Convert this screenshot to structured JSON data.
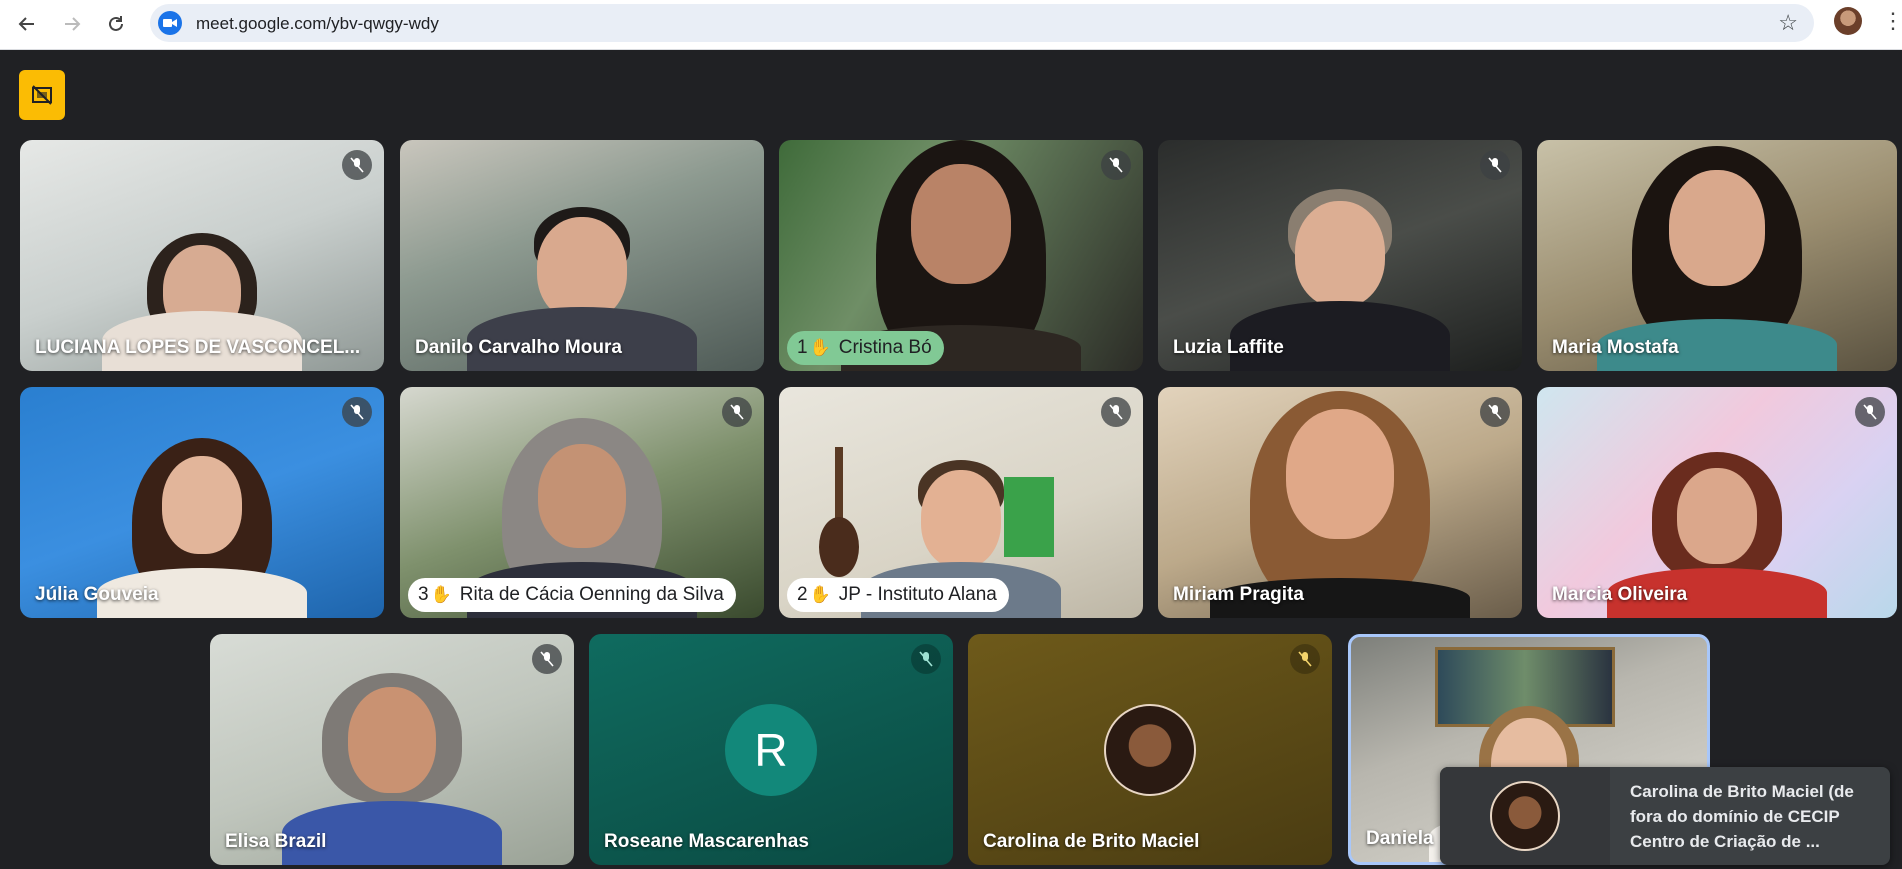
{
  "browser": {
    "url": "meet.google.com/ybv-qwgy-wdy",
    "back_icon": "arrow-left-icon",
    "forward_icon": "arrow-right-icon",
    "reload_icon": "reload-icon",
    "star_icon": "star-icon"
  },
  "colors": {
    "meet_bg": "#202124",
    "badge": "#fbbc04",
    "active_border": "#a8c7fa",
    "hand_pill": "#81c995"
  },
  "participants": {
    "p1": {
      "name": "LUCIANA LOPES DE VASCONCEL..."
    },
    "p2": {
      "name": "Danilo Carvalho Moura"
    },
    "p3": {
      "name": "Cristina Bó",
      "hand_order": "1"
    },
    "p4": {
      "name": "Luzia Laffite"
    },
    "p5": {
      "name": "Maria Mostafa"
    },
    "p6": {
      "name": "Júlia Gouveia"
    },
    "p7": {
      "name": "Rita de Cácia Oenning da Silva",
      "hand_order": "3"
    },
    "p8": {
      "name": "JP - Instituto Alana",
      "hand_order": "2"
    },
    "p9": {
      "name": "Miriam Pragita"
    },
    "p10": {
      "name": "Marcia Oliveira"
    },
    "p11": {
      "name": "Elisa Brazil"
    },
    "p12": {
      "name": "Roseane Mascarenhas",
      "initial": "R"
    },
    "p13": {
      "name": "Carolina de Brito Maciel"
    },
    "p14": {
      "name": "Daniela"
    }
  },
  "notification": {
    "text": "Carolina de Brito Maciel (de fora do domínio de CECIP Centro de Criação de ..."
  }
}
